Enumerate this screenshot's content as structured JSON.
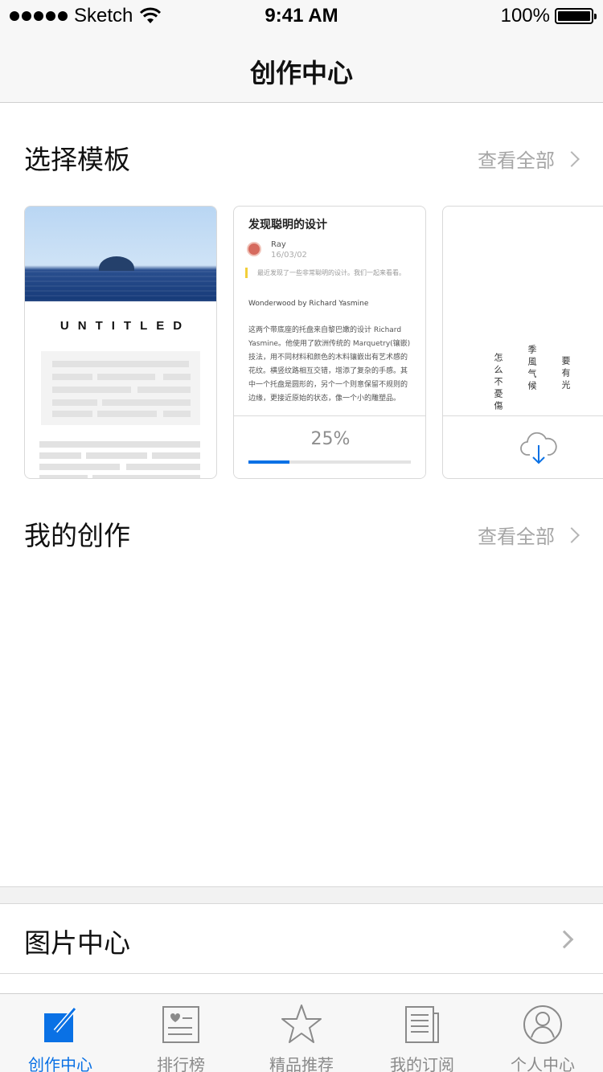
{
  "status_bar": {
    "carrier": "Sketch",
    "time": "9:41 AM",
    "battery": "100%"
  },
  "nav": {
    "title": "创作中心"
  },
  "templates_section": {
    "title": "选择模板",
    "see_all": "查看全部"
  },
  "templates": [
    {
      "name": "untitled-template",
      "heading": "UNTITLED"
    },
    {
      "name": "article-template",
      "title": "发现聪明的设计",
      "author": "Ray",
      "date": "16/03/02",
      "quote": "最近发现了一些非常聪明的设计。我们一起来看看。",
      "subtitle": "Wonderwood by Richard Yasmine",
      "body": "这两个带底座的托盘来自黎巴嫩的设计 Richard Yasmine。他使用了欧洲传统的 Marquetry(镶嵌) 技法，用不同材料和颜色的木料镶嵌出有艺术感的花纹。横竖纹路相互交错，增添了复杂的手感。其中一个托盘是圆形的，另个一个则意保留不规则的边缘，更接近原始的状态，像一个小的雕塑品。",
      "progress_label": "25%",
      "progress": 0.25
    },
    {
      "name": "poem-template",
      "columns": [
        "要有光",
        "季風气候",
        "怎么不憂傷"
      ]
    }
  ],
  "my_works_section": {
    "title": "我的创作",
    "see_all": "查看全部"
  },
  "picture_center": {
    "label": "图片中心"
  },
  "tabs": [
    {
      "label": "创作中心",
      "icon": "pencil-square-icon",
      "active": true
    },
    {
      "label": "排行榜",
      "icon": "ranking-list-icon",
      "active": false
    },
    {
      "label": "精品推荐",
      "icon": "star-icon",
      "active": false
    },
    {
      "label": "我的订阅",
      "icon": "newspaper-icon",
      "active": false
    },
    {
      "label": "个人中心",
      "icon": "user-icon",
      "active": false
    }
  ],
  "colors": {
    "accent": "#0a71e5",
    "muted": "#a6a6a6",
    "bar_bg": "#f7f7f7"
  }
}
